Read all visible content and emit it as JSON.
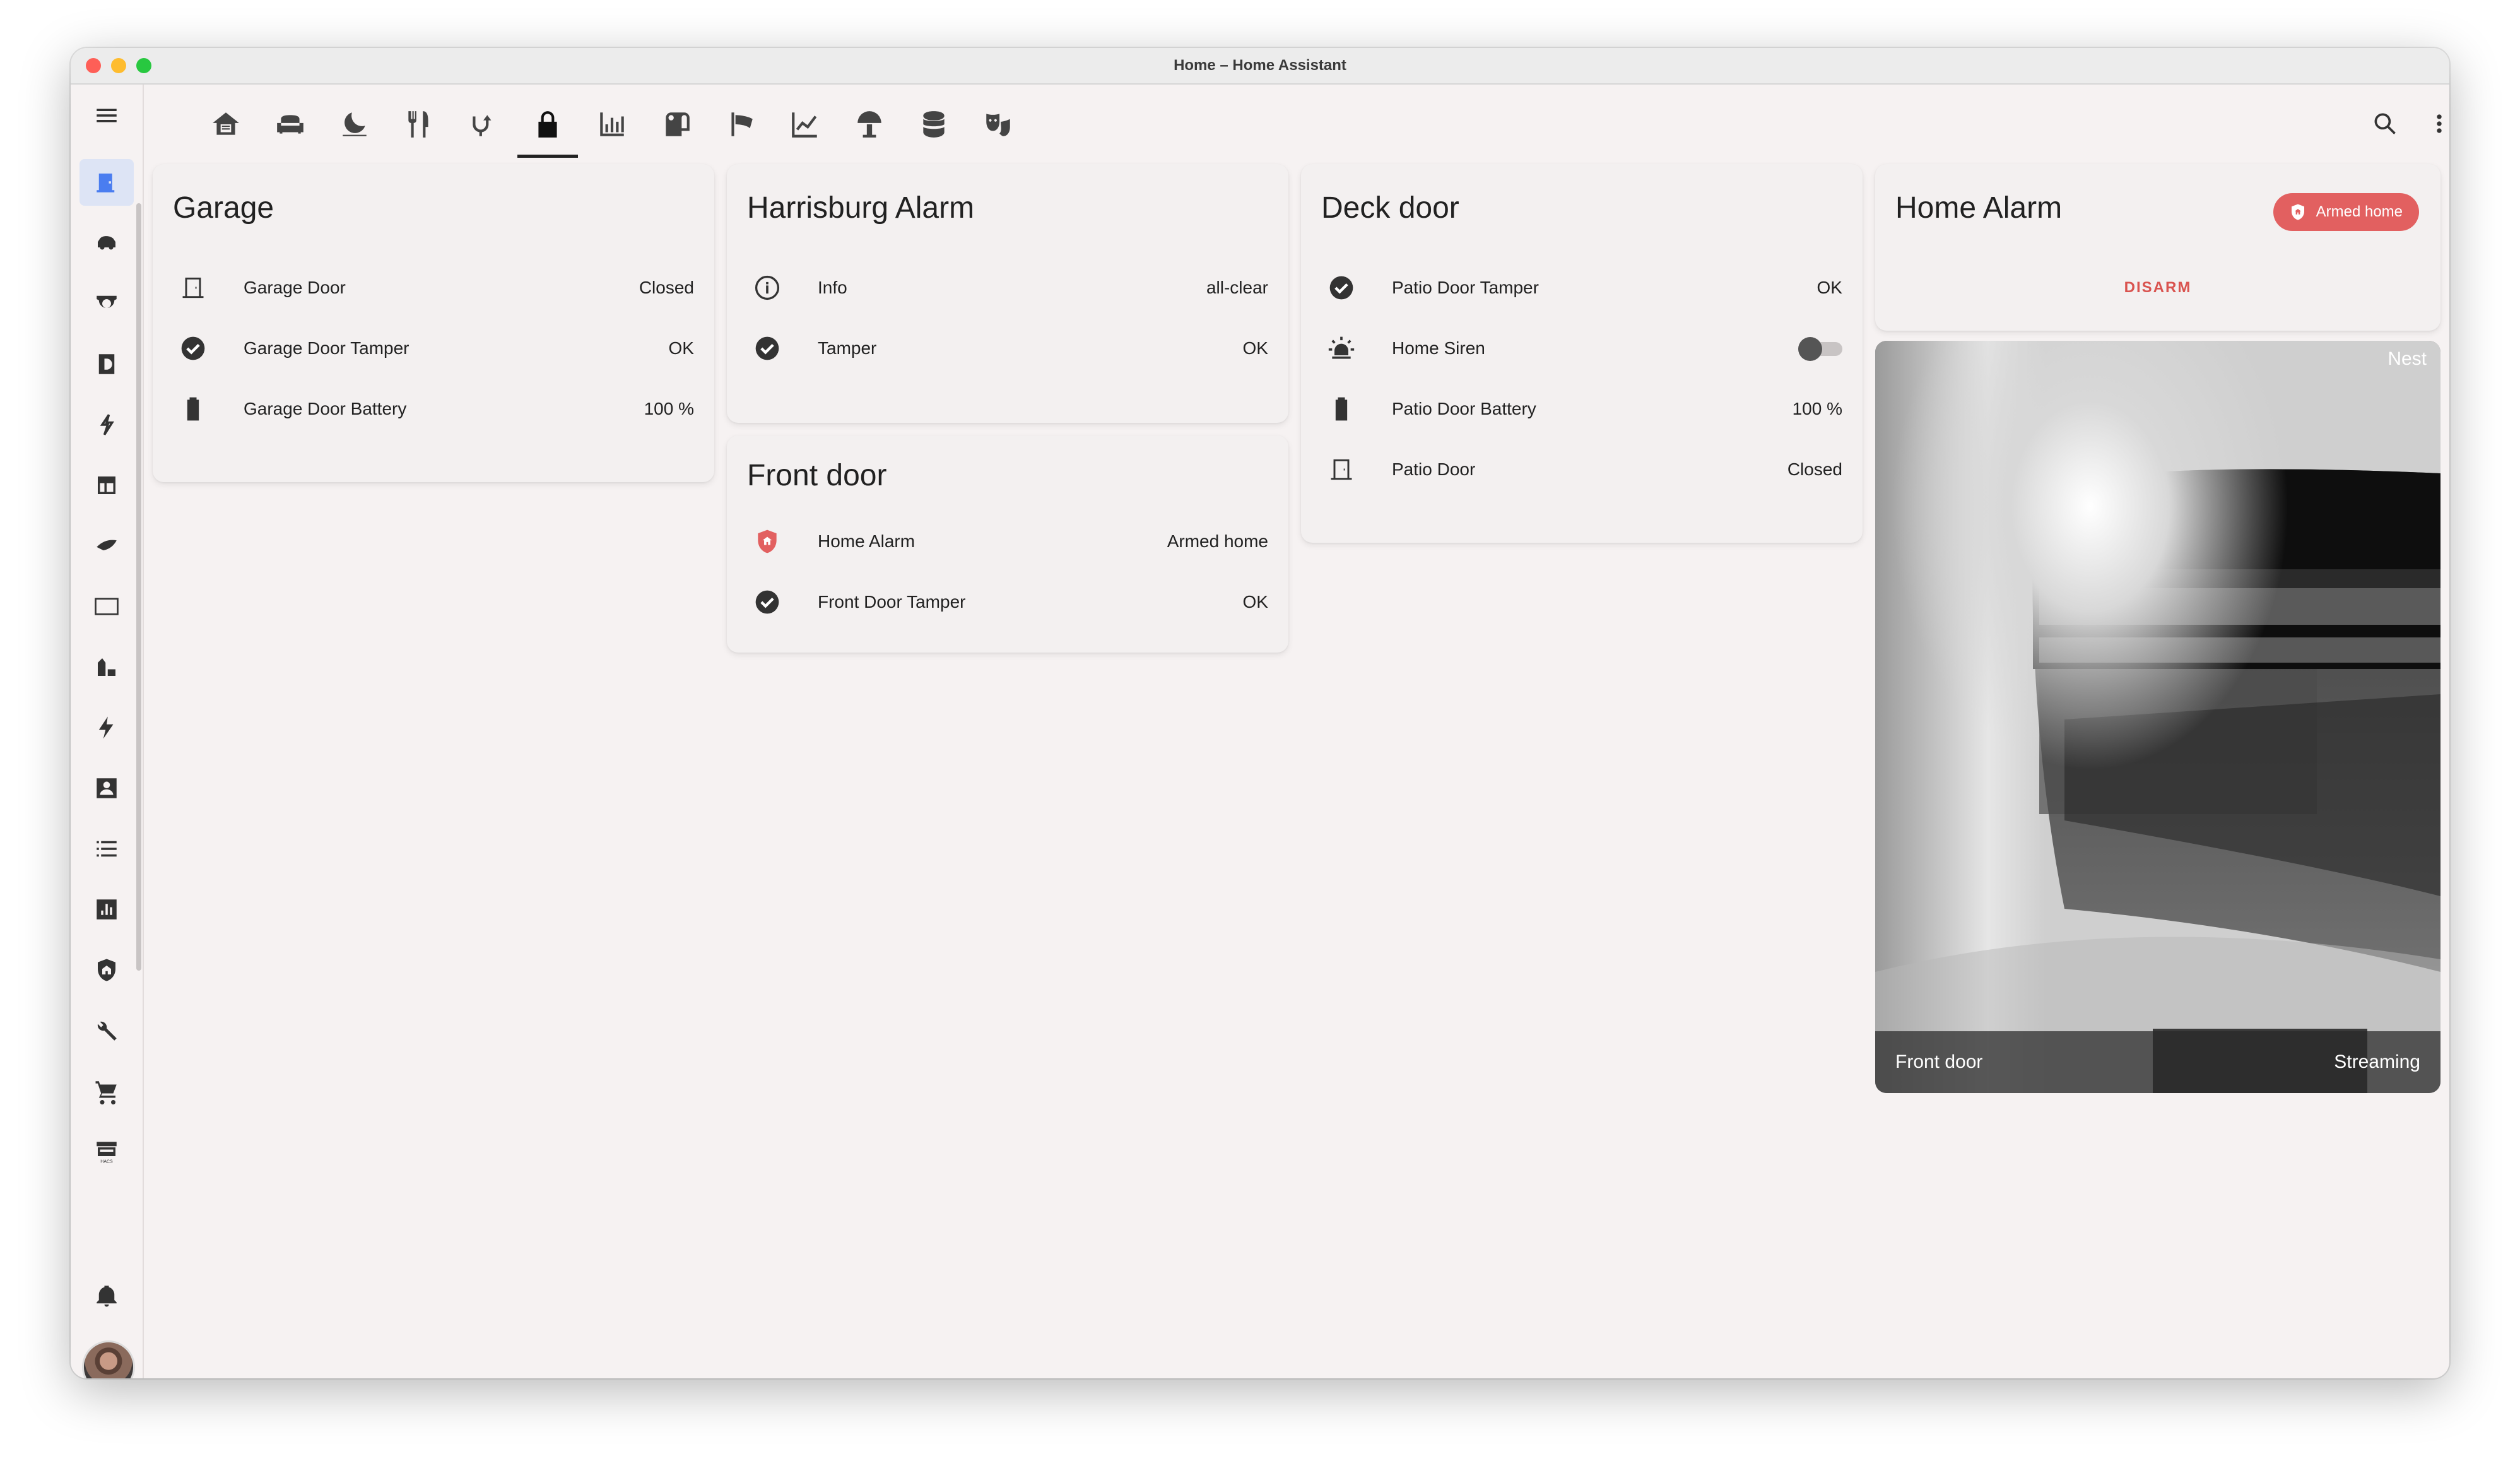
{
  "window": {
    "title": "Home – Home Assistant"
  },
  "sidebar": {
    "items": [
      {
        "icon": "menu-icon"
      },
      {
        "icon": "door-icon",
        "active": true
      },
      {
        "icon": "car-icon"
      },
      {
        "icon": "camera-dome-icon"
      },
      {
        "icon": "d-square-icon"
      },
      {
        "icon": "flash-icon"
      },
      {
        "icon": "table-icon"
      },
      {
        "icon": "rocket-icon"
      },
      {
        "icon": "rectangle-icon"
      },
      {
        "icon": "logbook-icon"
      },
      {
        "icon": "lightning-icon"
      },
      {
        "icon": "account-box-icon"
      },
      {
        "icon": "list-icon"
      },
      {
        "icon": "chart-box-icon"
      },
      {
        "icon": "shield-home-icon"
      },
      {
        "icon": "wrench-icon"
      },
      {
        "icon": "cart-icon"
      },
      {
        "icon": "hacs-icon"
      },
      {
        "icon": "bell-icon"
      }
    ]
  },
  "tabs": [
    {
      "icon": "home-garage-icon"
    },
    {
      "icon": "sofa-icon"
    },
    {
      "icon": "weather-night-icon"
    },
    {
      "icon": "silverware-icon"
    },
    {
      "icon": "shower-icon"
    },
    {
      "icon": "lock-icon",
      "active": true
    },
    {
      "icon": "chart-bar-icon"
    },
    {
      "icon": "paper-roll-icon"
    },
    {
      "icon": "sprinkler-icon"
    },
    {
      "icon": "chart-line-icon"
    },
    {
      "icon": "lamp-icon"
    },
    {
      "icon": "database-icon"
    },
    {
      "icon": "drama-masks-icon"
    }
  ],
  "cards": {
    "garage": {
      "title": "Garage",
      "rows": [
        {
          "icon": "door-icon",
          "name": "Garage Door",
          "value": "Closed"
        },
        {
          "icon": "check-circle-icon",
          "name": "Garage Door Tamper",
          "value": "OK"
        },
        {
          "icon": "battery-icon",
          "name": "Garage Door Battery",
          "value": "100 %"
        }
      ]
    },
    "harrisburg": {
      "title": "Harrisburg Alarm",
      "rows": [
        {
          "icon": "info-icon",
          "name": "Info",
          "value": "all-clear"
        },
        {
          "icon": "check-circle-icon",
          "name": "Tamper",
          "value": "OK"
        }
      ]
    },
    "front_door": {
      "title": "Front door",
      "rows": [
        {
          "icon": "shield-home-icon",
          "name": "Home Alarm",
          "value": "Armed home"
        },
        {
          "icon": "check-circle-icon",
          "name": "Front Door Tamper",
          "value": "OK"
        }
      ]
    },
    "deck_door": {
      "title": "Deck door",
      "rows": [
        {
          "icon": "check-circle-icon",
          "name": "Patio Door Tamper",
          "value": "OK"
        },
        {
          "icon": "alarm-light-icon",
          "name": "Home Siren",
          "value": ""
        },
        {
          "icon": "battery-icon",
          "name": "Patio Door Battery",
          "value": "100 %"
        },
        {
          "icon": "door-icon",
          "name": "Patio Door",
          "value": "Closed"
        }
      ]
    },
    "home_alarm": {
      "title": "Home Alarm",
      "badge": "Armed home",
      "action": "DISARM"
    },
    "camera": {
      "source": "Nest",
      "name": "Front door",
      "status": "Streaming"
    }
  },
  "colors": {
    "alarm_red": "#e26060",
    "active_blue": "#4a7df0"
  }
}
